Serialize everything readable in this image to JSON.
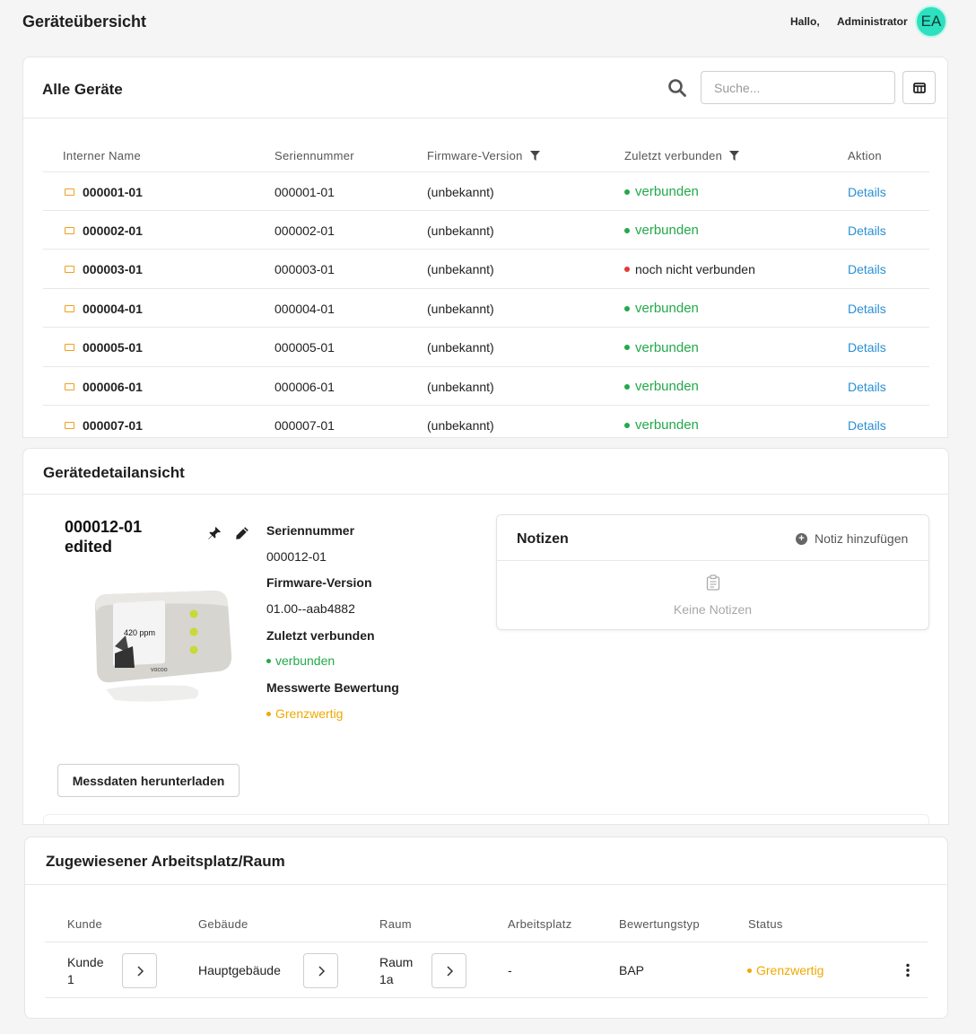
{
  "header": {
    "title": "Geräteübersicht",
    "greeting": "Hallo,",
    "username": "Administrator",
    "avatar_initials": "EA"
  },
  "devices": {
    "title": "Alle Geräte",
    "search_placeholder": "Suche...",
    "columns": {
      "name": "Interner Name",
      "serial": "Seriennummer",
      "firmware": "Firmware-Version",
      "last_connected": "Zuletzt verbunden",
      "action": "Aktion"
    },
    "rows": [
      {
        "name": "000001-01",
        "serial": "000001-01",
        "firmware": "(unbekannt)",
        "status": "verbunden",
        "action": "Details"
      },
      {
        "name": "000002-01",
        "serial": "000002-01",
        "firmware": "(unbekannt)",
        "status": "verbunden",
        "action": "Details"
      },
      {
        "name": "000003-01",
        "serial": "000003-01",
        "firmware": "(unbekannt)",
        "status": "noch nicht verbunden",
        "action": "Details"
      },
      {
        "name": "000004-01",
        "serial": "000004-01",
        "firmware": "(unbekannt)",
        "status": "verbunden",
        "action": "Details"
      },
      {
        "name": "000005-01",
        "serial": "000005-01",
        "firmware": "(unbekannt)",
        "status": "verbunden",
        "action": "Details"
      },
      {
        "name": "000006-01",
        "serial": "000006-01",
        "firmware": "(unbekannt)",
        "status": "verbunden",
        "action": "Details"
      },
      {
        "name": "000007-01",
        "serial": "000007-01",
        "firmware": "(unbekannt)",
        "status": "verbunden",
        "action": "Details"
      }
    ]
  },
  "detail": {
    "title": "Gerätedetailansicht",
    "device_name_line1": "000012-01",
    "device_name_line2": "edited",
    "device_screen_reading": "420 ppm",
    "device_brand": "vocoo",
    "serial_label": "Seriennummer",
    "serial_value": "000012-01",
    "firmware_label": "Firmware-Version",
    "firmware_value": "01.00--aab4882",
    "last_connected_label": "Zuletzt verbunden",
    "last_connected_value": "verbunden",
    "rating_label": "Messwerte Bewertung",
    "rating_value": "Grenzwertig",
    "download_button": "Messdaten herunterladen",
    "notes": {
      "title": "Notizen",
      "add_label": "Notiz hinzufügen",
      "empty_text": "Keine Notizen"
    }
  },
  "assignment": {
    "title": "Zugewiesener Arbeitsplatz/Raum",
    "columns": {
      "customer": "Kunde",
      "building": "Gebäude",
      "room": "Raum",
      "workplace": "Arbeitsplatz",
      "rating_type": "Bewertungstyp",
      "status": "Status"
    },
    "row": {
      "customer_line1": "Kunde",
      "customer_line2": "1",
      "building": "Hauptgebäude",
      "room_line1": "Raum",
      "room_line2": "1a",
      "workplace": "-",
      "rating_type": "BAP",
      "status": "Grenzwertig"
    }
  },
  "colors": {
    "connected": "#22a94a",
    "not_connected": "#e53935",
    "borderline": "#f0a800",
    "link": "#2a8fd4",
    "avatar": "#2de0c0"
  }
}
